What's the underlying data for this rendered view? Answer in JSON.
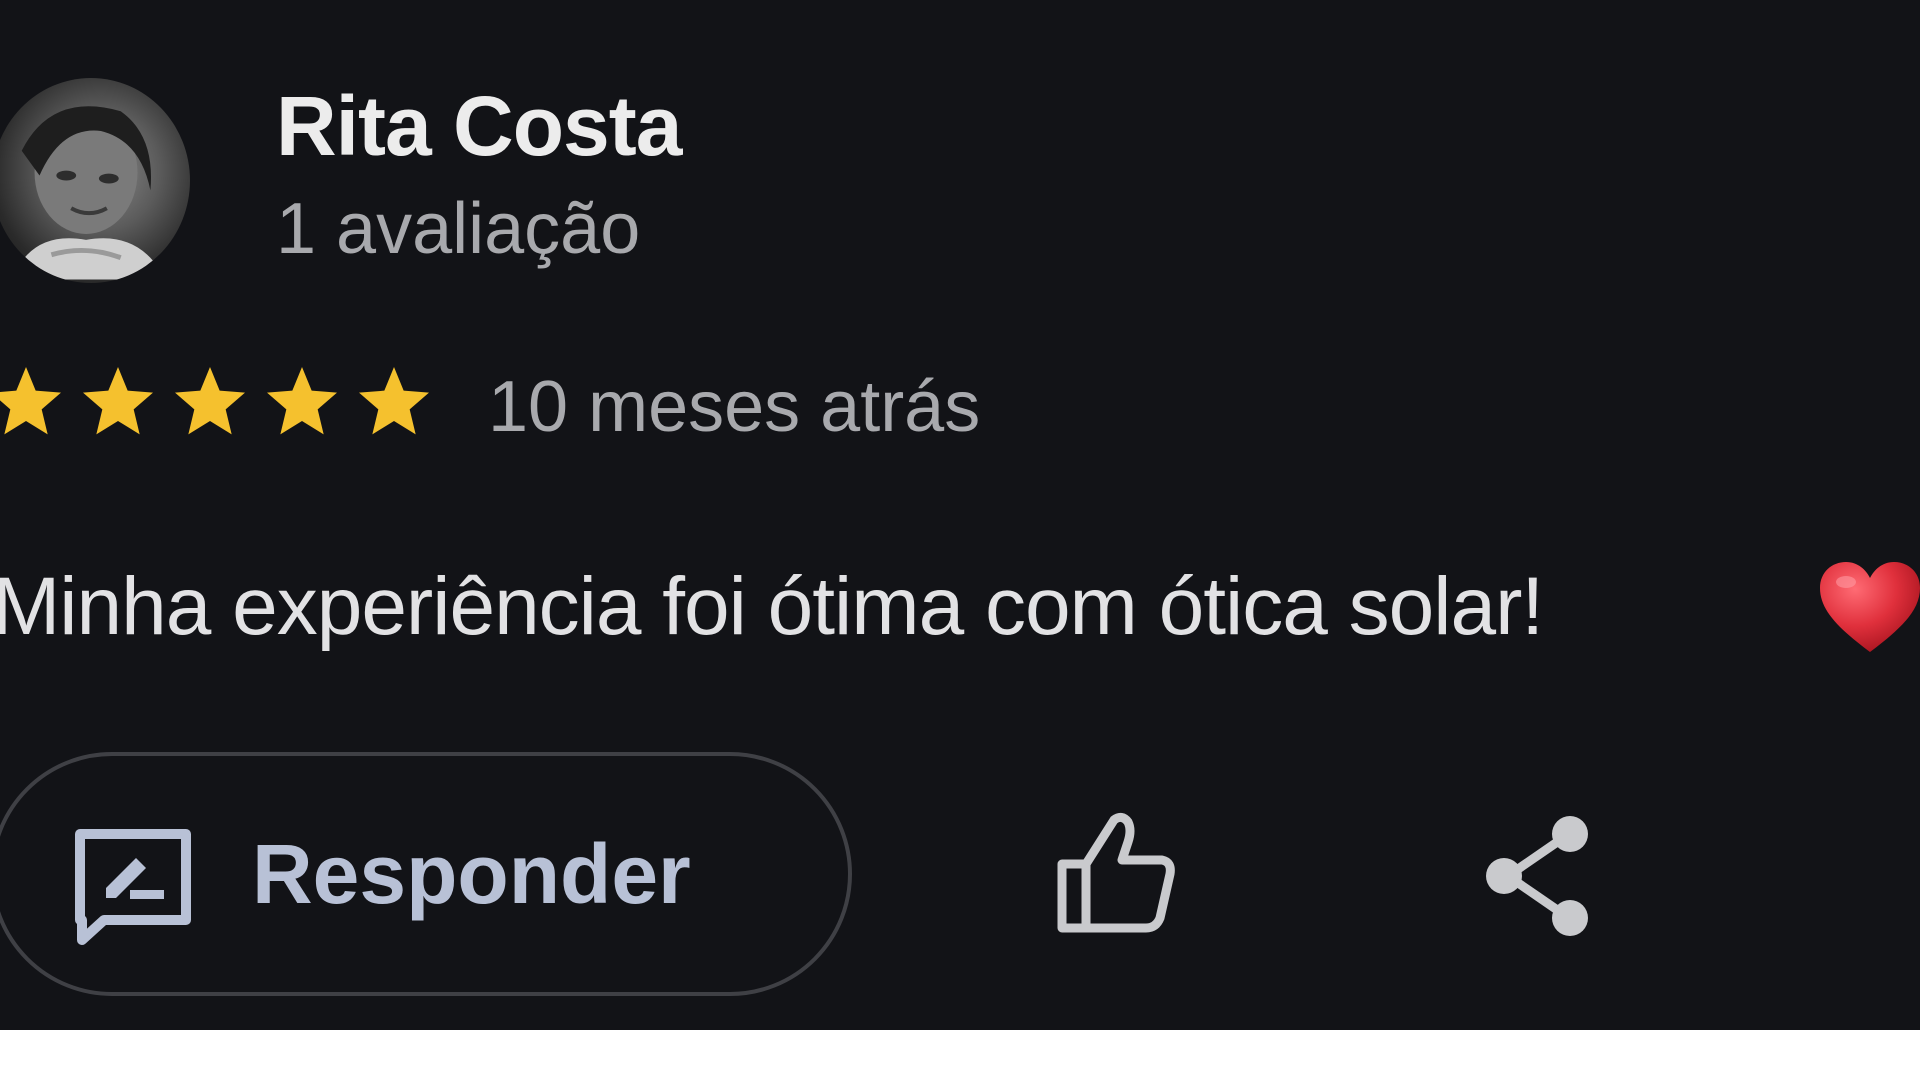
{
  "review": {
    "reviewer_name": "Rita Costa",
    "review_count": "1 avaliação",
    "rating": 5,
    "rating_max": 5,
    "time_ago": "10 meses atrás",
    "text": "Minha experiência foi ótima com ótica solar!",
    "emoji": "heart"
  },
  "actions": {
    "reply_label": "Responder",
    "reply_icon": "reply-edit-icon",
    "like_icon": "thumbs-up-icon",
    "share_icon": "share-icon"
  },
  "colors": {
    "background": "#121317",
    "star": "#f5c12e",
    "heart": "#e0303c",
    "reply_accent": "#b8c1d6"
  }
}
